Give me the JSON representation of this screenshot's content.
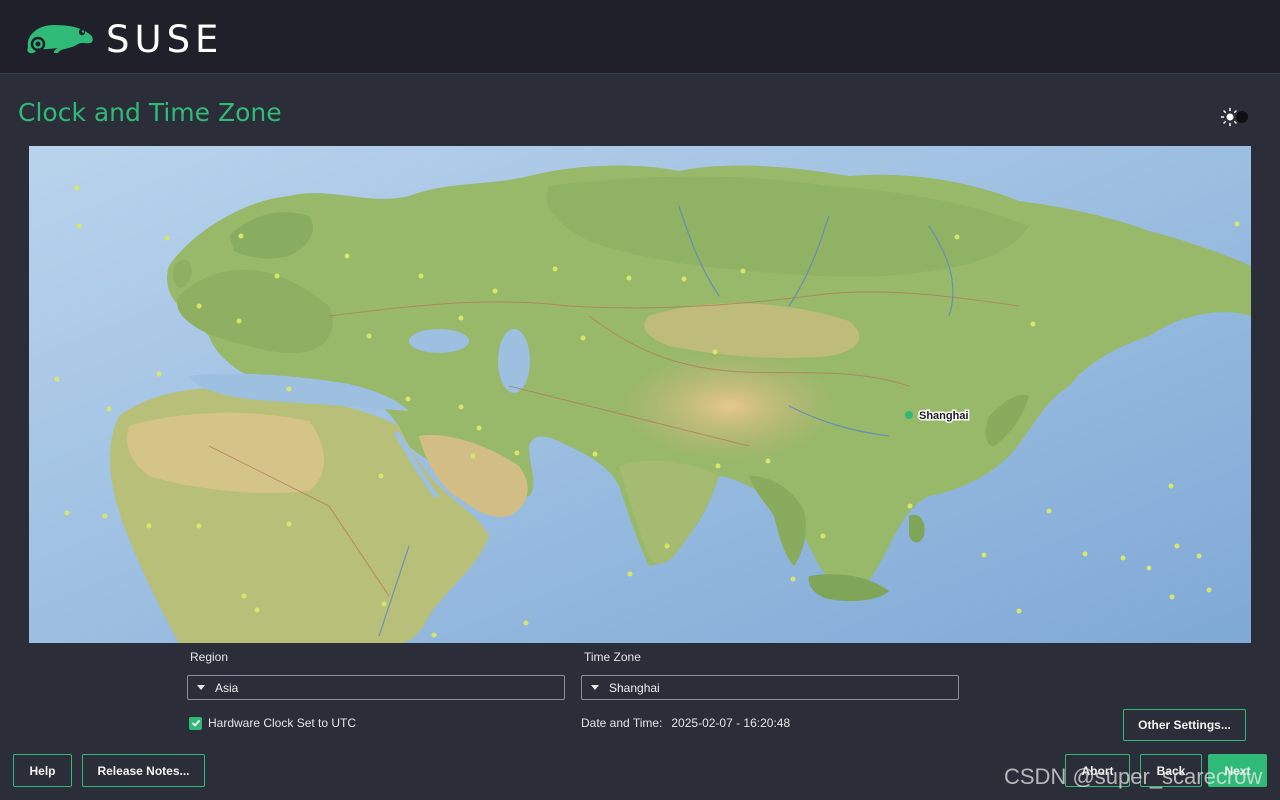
{
  "header": {
    "brand": "SUSE",
    "logo_icon": "chameleon-icon"
  },
  "page": {
    "title": "Clock and Time Zone",
    "theme_toggle_icon": "sun-moon-icon"
  },
  "map": {
    "selected_city": "Shanghai",
    "marker_color": "#30ba78"
  },
  "region": {
    "label": "Region",
    "value": "Asia"
  },
  "timezone": {
    "label": "Time Zone",
    "value": "Shanghai"
  },
  "hardware_clock": {
    "label": "Hardware Clock Set to UTC",
    "checked": true
  },
  "datetime": {
    "label": "Date and Time:",
    "value": "2025-02-07 - 16:20:48"
  },
  "buttons": {
    "other_settings": "Other Settings...",
    "help": "Help",
    "release_notes": "Release Notes...",
    "abort": "Abort",
    "back": "Back",
    "next": "Next"
  },
  "watermark": "CSDN @super_scarecrow",
  "colors": {
    "accent": "#30ba78",
    "background": "#2b2d38",
    "header": "#1f2029"
  }
}
